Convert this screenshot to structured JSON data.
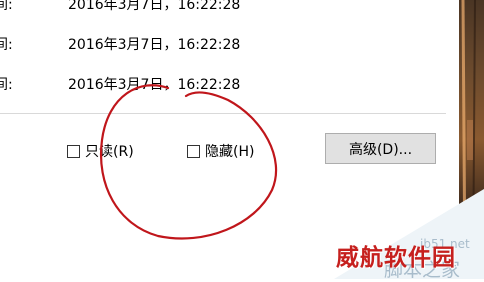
{
  "timestamps": [
    {
      "label": "时间:",
      "value": "2016年3月7日，16:22:28"
    },
    {
      "label": "时间:",
      "value": "2016年3月7日，16:22:28"
    },
    {
      "label": "时间:",
      "value": "2016年3月7日，16:22:28"
    }
  ],
  "attributes": {
    "readonly_label": "只读(R)",
    "readonly_checked": false,
    "hidden_label": "隐藏(H)",
    "hidden_checked": false,
    "advanced_button": "高级(D)..."
  },
  "watermark": {
    "brand": "威航软件园",
    "site": "jb51.net",
    "tagline": "脚本之家"
  },
  "colors": {
    "annotation_circle": "#c0161b",
    "watermark_red": "#c6201e",
    "button_face": "#e1e1e1"
  },
  "icons": {
    "checkbox_readonly": "checkbox-unchecked",
    "checkbox_hidden": "checkbox-unchecked"
  }
}
